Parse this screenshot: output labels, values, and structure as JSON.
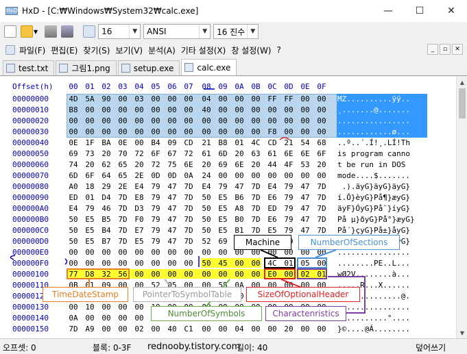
{
  "window": {
    "title": "HxD - [C:₩Windows₩System32₩calc.exe]",
    "app_icon_text": "HxD",
    "controls": [
      "—",
      "☐",
      "✕"
    ]
  },
  "toolbar": {
    "bytes_per_row": "16",
    "charset": "ANSI",
    "base": "16 진수"
  },
  "menu": [
    "파일(F)",
    "편집(E)",
    "찾기(S)",
    "보기(V)",
    "분석(A)",
    "기타 설정(X)",
    "창 설정(W)",
    "?"
  ],
  "tabs": [
    "test.txt",
    "그림1.png",
    "setup.exe",
    "calc.exe"
  ],
  "hex": {
    "offset_header": "Offset(h)",
    "columns": [
      "00",
      "01",
      "02",
      "03",
      "04",
      "05",
      "06",
      "07",
      "08",
      "09",
      "0A",
      "0B",
      "0C",
      "0D",
      "0E",
      "0F"
    ],
    "rows": [
      {
        "offset": "00000000",
        "bytes": "4D 5A 90 00 03 00 00 00 04 00 00 00 FF FF 00 00",
        "ascii": "MZ..........ÿÿ.."
      },
      {
        "offset": "00000010",
        "bytes": "B8 00 00 00 00 00 00 00 40 00 00 00 00 00 00 00",
        "ascii": "¸.......@......."
      },
      {
        "offset": "00000020",
        "bytes": "00 00 00 00 00 00 00 00 00 00 00 00 00 00 00 00",
        "ascii": "................"
      },
      {
        "offset": "00000030",
        "bytes": "00 00 00 00 00 00 00 00 00 00 00 00 F8 00 00 00",
        "ascii": "............ø..."
      },
      {
        "offset": "00000040",
        "bytes": "0E 1F BA 0E 00 B4 09 CD 21 B8 01 4C CD 21 54 68",
        "ascii": "..º..´.Í!¸.LÍ!Th"
      },
      {
        "offset": "00000050",
        "bytes": "69 73 20 70 72 6F 67 72 61 6D 20 63 61 6E 6E 6F",
        "ascii": "is program canno"
      },
      {
        "offset": "00000060",
        "bytes": "74 20 62 65 20 72 75 6E 20 69 6E 20 44 4F 53 20",
        "ascii": "t be run in DOS "
      },
      {
        "offset": "00000070",
        "bytes": "6D 6F 64 65 2E 0D 0D 0A 24 00 00 00 00 00 00 00",
        "ascii": "mode....$......."
      },
      {
        "offset": "00000080",
        "bytes": "A0 18 29 2E E4 79 47 7D E4 79 47 7D E4 79 47 7D",
        "ascii": " .).äyG}äyG}äyG}"
      },
      {
        "offset": "00000090",
        "bytes": "ED 01 D4 7D E8 79 47 7D 50 E5 B6 7D E6 79 47 7D",
        "ascii": "í.Ô}èyG}På¶}æyG}"
      },
      {
        "offset": "000000A0",
        "bytes": "E4 79 46 7D D3 79 47 7D 50 E5 A8 7D ED 79 47 7D",
        "ascii": "äyF}ÓyG}På¨}íyG}"
      },
      {
        "offset": "000000B0",
        "bytes": "50 E5 B5 7D F0 79 47 7D 50 E5 B0 7D E6 79 47 7D",
        "ascii": "På µ}ðyG}På°}æyG}"
      },
      {
        "offset": "000000C0",
        "bytes": "50 E5 B4 7D E7 79 47 7D 50 E5 B1 7D E5 79 47 7D",
        "ascii": "På´}çyG}På±}åyG}"
      },
      {
        "offset": "000000D0",
        "bytes": "50 E5 B7 7D E5 79 47 7D 52 69 63 68 E4 79 47 7D",
        "ascii": "På·}åyG}RichäyG}"
      },
      {
        "offset": "000000E0",
        "bytes": "00 00 00 00 00 00 00 00 00 00 00 00 00 00 00 00",
        "ascii": "................"
      },
      {
        "offset": "000000F0",
        "bytes": "00 00 00 00 00 00 00 00 50 45 00 00 4C 01 05 00",
        "ascii": "........PE..L..."
      },
      {
        "offset": "00000100",
        "bytes": "77 D8 32 56 00 00 00 00 00 00 00 00 E0 00 02 01",
        "ascii": "wØ2V........à..."
      },
      {
        "offset": "00000110",
        "bytes": "0B 01 09 00 00 52 05 00 00 58 0A 00 00 00 00 00",
        "ascii": ".....R...X......"
      },
      {
        "offset": "00000120",
        "bytes": "0C 00 00 00 00 00 00 00 00 00 00 00 00 40 00 00",
        "ascii": "..............@."
      },
      {
        "offset": "00000130",
        "bytes": "00 10 00 00 00 10 00 00 00 00 00 00 00 00 00 00",
        "ascii": "................"
      },
      {
        "offset": "00000140",
        "bytes": "0A 00 00 00 00 00 00 00 00 00 00 00 00 00 00 00",
        "ascii": "...........°...."
      },
      {
        "offset": "00000150",
        "bytes": "7D A9 00 00 02 00 40 C1 00 00 04 00 00 20 00 00",
        "ascii": "}©....@Á........"
      }
    ]
  },
  "annotations": {
    "machine": "Machine",
    "number_of_sections": "NumberOfSections",
    "time_date_stamp": "TimeDateStamp",
    "pointer_to_symbol_table": "PointerToSymbolTable",
    "size_of_optional_header": "SizeOfOptionalHeader",
    "number_of_symbols": "NumberOfSymbols",
    "characteristics": "Charactenristics",
    "colors": {
      "machine": "#000000",
      "number_of_sections": "#4a90d9",
      "time_date_stamp": "#e67e22",
      "pointer": "#b0b0b0",
      "size_opt": "#e02020",
      "num_symbols": "#6ab04c",
      "characteristics": "#7b3fa0"
    }
  },
  "status": {
    "offset": "오프셋: 0",
    "block": "블록: 0-3F",
    "watermark": "rednooby.tistory.com",
    "length": "길이: 40",
    "mode": "덮어쓰기"
  }
}
